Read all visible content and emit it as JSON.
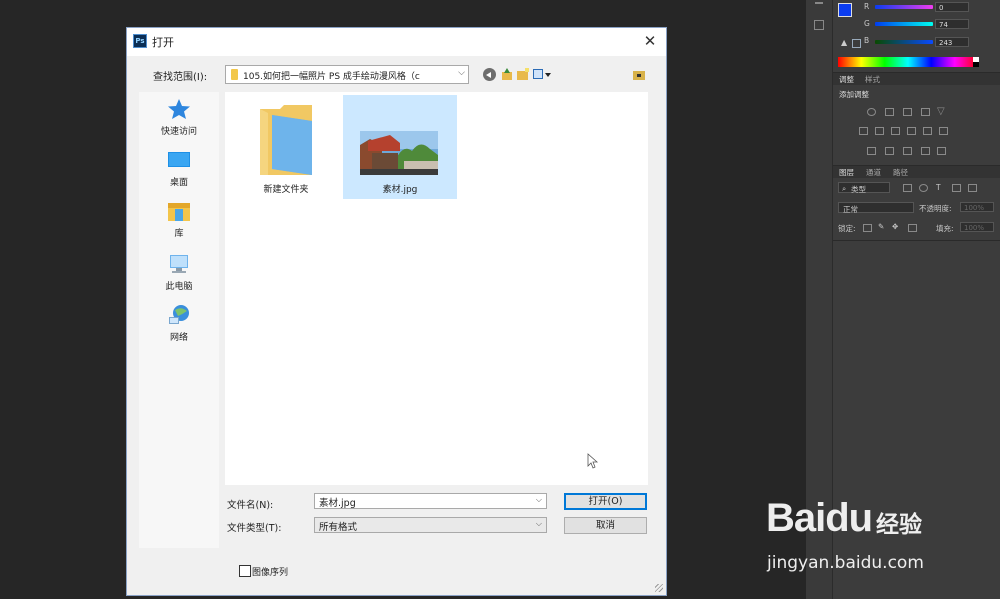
{
  "dialog": {
    "title": "打开",
    "app_icon_text": "Ps",
    "close_glyph": "✕",
    "look_in_label": "查找范围(I):",
    "look_in_value": "105.如何把一幅照片 PS 成手绘动漫风格（c",
    "places": [
      {
        "label": "快速访问",
        "icon": "star-icon"
      },
      {
        "label": "桌面",
        "icon": "desktop-icon"
      },
      {
        "label": "库",
        "icon": "library-icon"
      },
      {
        "label": "此电脑",
        "icon": "computer-icon"
      },
      {
        "label": "网络",
        "icon": "network-icon"
      }
    ],
    "files": [
      {
        "name": "新建文件夹",
        "type": "folder",
        "selected": false
      },
      {
        "name": "素材.jpg",
        "type": "image",
        "selected": true
      }
    ],
    "filename_label": "文件名(N):",
    "filename_value": "素材.jpg",
    "filetype_label": "文件类型(T):",
    "filetype_value": "所有格式",
    "open_button": "打开(O)",
    "cancel_button": "取消",
    "image_sequence_label": "图像序列",
    "image_sequence_checked": false
  },
  "photoshop": {
    "color": {
      "r_label": "R",
      "g_label": "G",
      "b_label": "B",
      "r": "0",
      "g": "74",
      "b": "243"
    },
    "adjustments_tab": "调整",
    "styles_tab": "样式",
    "add_adjustment": "添加调整",
    "layers_tab": "图层",
    "channels_tab": "通道",
    "paths_tab": "路径",
    "kind_filter": "类型",
    "blend_mode": "正常",
    "opacity_label": "不透明度:",
    "opacity_value": "100%",
    "lock_label": "锁定:",
    "fill_label": "填充:",
    "fill_value": "100%",
    "foreground_color": "#0a3cf0"
  },
  "watermark": {
    "logo_text": "Baidu",
    "logo_cn": "经验",
    "url": "jingyan.baidu.com"
  }
}
